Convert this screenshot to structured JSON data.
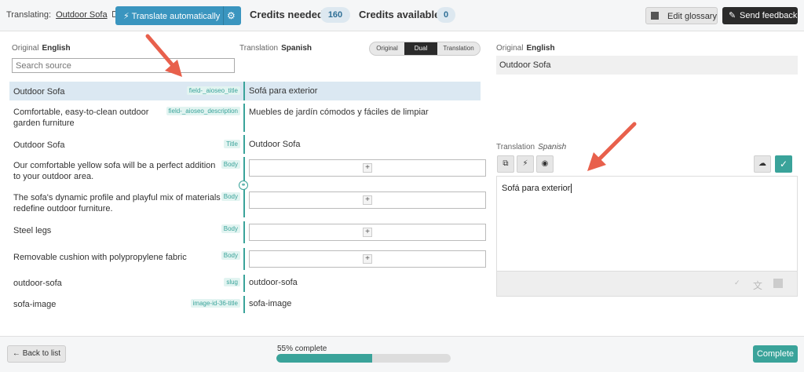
{
  "header": {
    "translating_label": "Translating:",
    "translating_target": "Outdoor Sofa",
    "translate_auto_label": "Translate automatically",
    "credits_needed_label": "Credits needed",
    "credits_needed_value": "160",
    "credits_available_label": "Credits available",
    "credits_available_value": "0",
    "edit_glossary_label": "Edit glossary",
    "send_feedback_label": "Send feedback"
  },
  "left": {
    "original_label": "Original",
    "original_lang": "English",
    "translation_label": "Translation",
    "translation_lang": "Spanish",
    "search_placeholder": "Search source",
    "view_modes": [
      "Original",
      "Dual",
      "Translation"
    ],
    "active_view_mode": "Dual"
  },
  "rows": [
    {
      "source": "Outdoor Sofa",
      "tag": "field-_aioseo_title",
      "target": "Sofá para exterior",
      "selected": true
    },
    {
      "source": "Comfortable, easy-to-clean outdoor garden furniture",
      "tag": "field-_aioseo_description",
      "target": "Muebles de jardín cómodos y fáciles de limpiar"
    },
    {
      "source": "Outdoor Sofa",
      "tag": "Title",
      "target": "Outdoor Sofa"
    },
    {
      "source": "Our comfortable yellow sofa will be a perfect addition to your outdoor area.",
      "tag": "Body",
      "target": ""
    },
    {
      "source": "The sofa's dynamic profile and playful mix of materials redefine outdoor furniture.",
      "tag": "Body",
      "target": ""
    },
    {
      "source": "Steel legs",
      "tag": "Body",
      "target": ""
    },
    {
      "source": "Removable cushion with polypropylene fabric",
      "tag": "Body",
      "target": ""
    },
    {
      "source": "outdoor-sofa",
      "tag": "slug",
      "target": "outdoor-sofa"
    },
    {
      "source": "sofa-image",
      "tag": "image-id-36-title",
      "target": "sofa-image"
    }
  ],
  "right": {
    "original_label": "Original",
    "original_lang": "English",
    "original_text": "Outdoor Sofa",
    "translation_label": "Translation",
    "translation_lang": "Spanish",
    "translation_text": "Sofá para exterior"
  },
  "footer": {
    "back_label": "← Back to list",
    "progress_label": "55% complete",
    "progress_value": 0.55,
    "complete_label": "Complete"
  },
  "colors": {
    "accent": "#3aa39a",
    "blue_button": "#3a95bf",
    "annotation_arrow": "#e8604c"
  }
}
